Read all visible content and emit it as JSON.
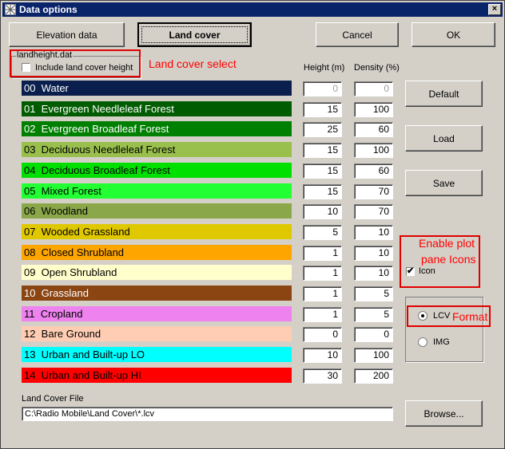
{
  "window": {
    "title": "Data options",
    "close_glyph": "×"
  },
  "top_buttons": {
    "elevation": "Elevation data",
    "landcover": "Land cover",
    "cancel": "Cancel",
    "ok": "OK"
  },
  "group": {
    "title": "landheight.dat",
    "checkbox_label": "Include land cover height",
    "checked": false
  },
  "columns": {
    "height": "Height (m)",
    "density": "Density (%)"
  },
  "rows": [
    {
      "code": "00",
      "name": "Water",
      "color": "#0a1f4d",
      "text_color": "#ffffff",
      "height": "0",
      "density": "0",
      "disabled": true
    },
    {
      "code": "01",
      "name": "Evergreen Needleleaf Forest",
      "color": "#005c00",
      "text_color": "#ffffff",
      "height": "15",
      "density": "100",
      "disabled": false
    },
    {
      "code": "02",
      "name": "Evergreen Broadleaf Forest",
      "color": "#008000",
      "text_color": "#ffffff",
      "height": "25",
      "density": "60",
      "disabled": false
    },
    {
      "code": "03",
      "name": "Deciduous Needleleaf Forest",
      "color": "#99bf4d",
      "text_color": "#000000",
      "height": "15",
      "density": "100",
      "disabled": false
    },
    {
      "code": "04",
      "name": "Deciduous Broadleaf Forest",
      "color": "#00e000",
      "text_color": "#000000",
      "height": "15",
      "density": "60",
      "disabled": false
    },
    {
      "code": "05",
      "name": "Mixed Forest",
      "color": "#22ff33",
      "text_color": "#000000",
      "height": "15",
      "density": "70",
      "disabled": false
    },
    {
      "code": "06",
      "name": "Woodland",
      "color": "#8aa84a",
      "text_color": "#000000",
      "height": "10",
      "density": "70",
      "disabled": false
    },
    {
      "code": "07",
      "name": "Wooded Grassland",
      "color": "#e0c800",
      "text_color": "#000000",
      "height": "5",
      "density": "10",
      "disabled": false
    },
    {
      "code": "08",
      "name": "Closed Shrubland",
      "color": "#ffa500",
      "text_color": "#000000",
      "height": "1",
      "density": "10",
      "disabled": false
    },
    {
      "code": "09",
      "name": "Open Shrubland",
      "color": "#ffffcc",
      "text_color": "#000000",
      "height": "1",
      "density": "10",
      "disabled": false
    },
    {
      "code": "10",
      "name": "Grassland",
      "color": "#8b4513",
      "text_color": "#ffffff",
      "height": "1",
      "density": "5",
      "disabled": false
    },
    {
      "code": "11",
      "name": "Cropland",
      "color": "#ee82ee",
      "text_color": "#000000",
      "height": "1",
      "density": "5",
      "disabled": false
    },
    {
      "code": "12",
      "name": "Bare Ground",
      "color": "#ffcdb3",
      "text_color": "#000000",
      "height": "0",
      "density": "0",
      "disabled": false
    },
    {
      "code": "13",
      "name": "Urban and Built-up LO",
      "color": "#00ffff",
      "text_color": "#000000",
      "height": "10",
      "density": "100",
      "disabled": false
    },
    {
      "code": "14",
      "name": "Urban and Built-up HI",
      "color": "#ff0000",
      "text_color": "#000000",
      "height": "30",
      "density": "200",
      "disabled": false
    }
  ],
  "side_buttons": {
    "default": "Default",
    "load": "Load",
    "save": "Save",
    "browse": "Browse..."
  },
  "icon_checkbox": {
    "label": "Icon",
    "checked": true
  },
  "format": {
    "lcv": "LCV",
    "img": "IMG",
    "selected": "LCV"
  },
  "file": {
    "label": "Land Cover File",
    "path": "C:\\Radio Mobile\\Land Cover\\*.lcv"
  },
  "annotations": {
    "landcover_select": "Land cover select",
    "enable_plot_line1": "Enable plot",
    "enable_plot_line2": "pane Icons",
    "format": "Format"
  }
}
